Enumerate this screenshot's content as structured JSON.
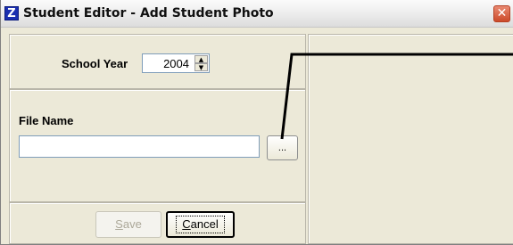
{
  "window": {
    "title": "Student Editor - Add Student Photo",
    "icon_letter": "Z",
    "close_label": "✕"
  },
  "school_year": {
    "label": "School Year",
    "value": "2004",
    "up_arrow": "▲",
    "down_arrow": "▼"
  },
  "file": {
    "label": "File Name",
    "value": "",
    "browse_label": "..."
  },
  "buttons": {
    "save_mnemonic": "S",
    "save_rest": "ave",
    "cancel_mnemonic": "C",
    "cancel_rest": "ancel"
  },
  "colors": {
    "window_bg": "#ece9d8",
    "close_red": "#cc4a2a",
    "disabled_text": "#aca899"
  }
}
